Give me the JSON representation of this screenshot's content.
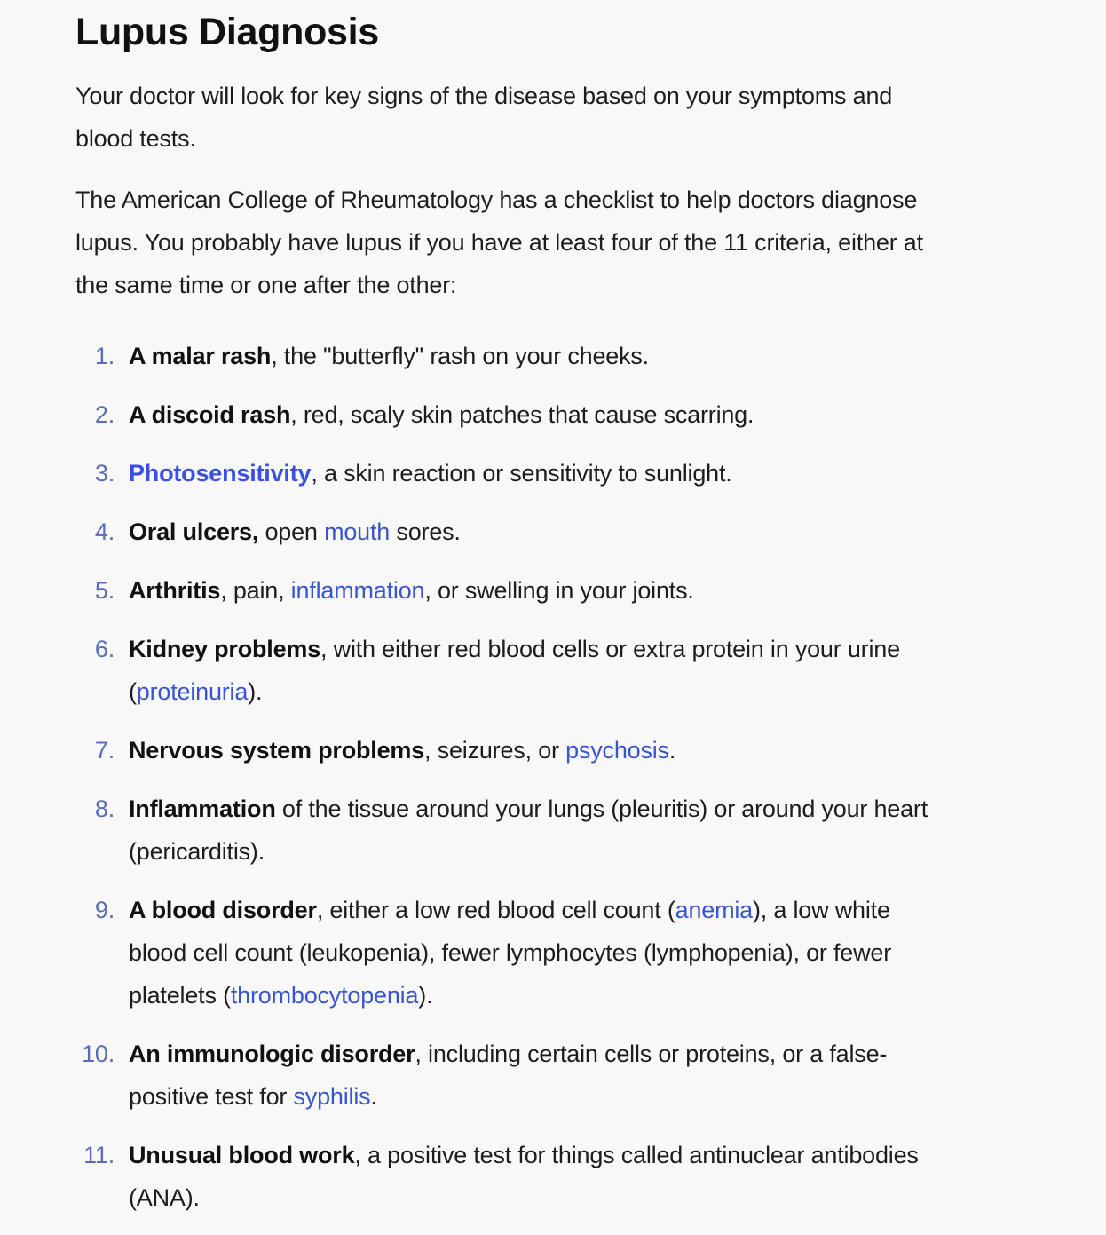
{
  "article": {
    "title": "Lupus Diagnosis",
    "intro": "Your doctor will look for key signs of the disease based on your symptoms and blood tests.",
    "checklist_intro": "The American College of Rheumatology has a checklist to help doctors diagnose lupus. You probably have lupus if you have at least four of the 11 criteria, either at the same time or one after the other:"
  },
  "criteria": [
    {
      "num": "1.",
      "parts": [
        {
          "t": "b",
          "v": "A malar rash"
        },
        {
          "t": "s",
          "v": ", the \"butterfly\" rash on your cheeks."
        }
      ]
    },
    {
      "num": "2.",
      "parts": [
        {
          "t": "b",
          "v": "A discoid rash"
        },
        {
          "t": "s",
          "v": ", red, scaly skin patches that cause scarring."
        }
      ]
    },
    {
      "num": "3.",
      "parts": [
        {
          "t": "lb",
          "v": "Photosensitivity"
        },
        {
          "t": "s",
          "v": ", a skin reaction or sensitivity to sunlight."
        }
      ]
    },
    {
      "num": "4.",
      "parts": [
        {
          "t": "b",
          "v": "Oral ulcers,"
        },
        {
          "t": "s",
          "v": " open "
        },
        {
          "t": "l",
          "v": "mouth"
        },
        {
          "t": "s",
          "v": " sores."
        }
      ]
    },
    {
      "num": "5.",
      "parts": [
        {
          "t": "b",
          "v": "Arthritis"
        },
        {
          "t": "s",
          "v": ", pain, "
        },
        {
          "t": "l",
          "v": "inflammation"
        },
        {
          "t": "s",
          "v": ", or swelling in your joints."
        }
      ]
    },
    {
      "num": "6.",
      "parts": [
        {
          "t": "b",
          "v": "Kidney problems"
        },
        {
          "t": "s",
          "v": ", with either red blood cells or extra protein in your urine ("
        },
        {
          "t": "l",
          "v": "proteinuria"
        },
        {
          "t": "s",
          "v": ")."
        }
      ]
    },
    {
      "num": "7.",
      "parts": [
        {
          "t": "b",
          "v": "Nervous system problems"
        },
        {
          "t": "s",
          "v": ", seizures, or "
        },
        {
          "t": "l",
          "v": "psychosis"
        },
        {
          "t": "s",
          "v": "."
        }
      ]
    },
    {
      "num": "8.",
      "parts": [
        {
          "t": "b",
          "v": "Inflammation"
        },
        {
          "t": "s",
          "v": " of the tissue around your lungs (pleuritis) or around your heart (pericarditis)."
        }
      ]
    },
    {
      "num": "9.",
      "parts": [
        {
          "t": "b",
          "v": "A blood disorder"
        },
        {
          "t": "s",
          "v": ", either a low red blood cell count ("
        },
        {
          "t": "l",
          "v": "anemia"
        },
        {
          "t": "s",
          "v": "), a low white blood cell count (leukopenia), fewer lymphocytes (lymphopenia), or fewer platelets ("
        },
        {
          "t": "l",
          "v": "thrombocytopenia"
        },
        {
          "t": "s",
          "v": ")."
        }
      ]
    },
    {
      "num": "10.",
      "parts": [
        {
          "t": "b",
          "v": "An immunologic disorder"
        },
        {
          "t": "s",
          "v": ", including certain cells or proteins, or a false-positive test for "
        },
        {
          "t": "l",
          "v": "syphilis"
        },
        {
          "t": "s",
          "v": "."
        }
      ]
    },
    {
      "num": "11.",
      "parts": [
        {
          "t": "b",
          "v": "Unusual blood work"
        },
        {
          "t": "s",
          "v": ", a positive test for things called antinuclear antibodies (ANA)."
        }
      ]
    }
  ],
  "colors": {
    "link": "#3a55d0",
    "list_number": "#5a6bb8",
    "text": "#1d1d1d",
    "background": "#f8f8f8"
  }
}
